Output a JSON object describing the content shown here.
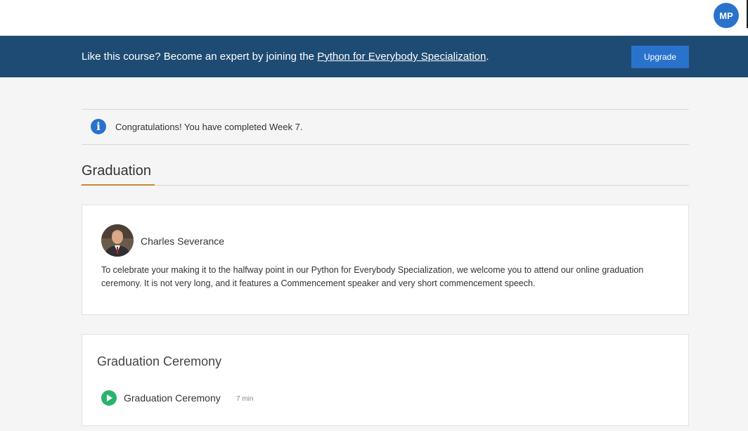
{
  "header": {
    "user_initials": "MP"
  },
  "banner": {
    "text_before": "Like this course? Become an expert by joining the ",
    "link_text": "Python for Everybody Specialization",
    "text_after": ".",
    "upgrade_label": "Upgrade"
  },
  "notice": {
    "icon": "info-icon",
    "text": "Congratulations! You have completed Week 7."
  },
  "section": {
    "title": "Graduation"
  },
  "instructor_note": {
    "name": "Charles Severance",
    "message": "To celebrate your making it to the halfway point in our Python for Everybody Specialization, we welcome you to attend our online graduation ceremony. It is not very long, and it features a Commencement speaker and very short commencement speech."
  },
  "lesson": {
    "title": "Graduation Ceremony",
    "items": [
      {
        "icon": "play-icon",
        "name": "Graduation Ceremony",
        "duration": "7 min"
      }
    ]
  },
  "colors": {
    "banner_bg": "#1d4b73",
    "accent": "#2a73cc",
    "play": "#2ab26f",
    "section_underline": "#c48a3a"
  }
}
